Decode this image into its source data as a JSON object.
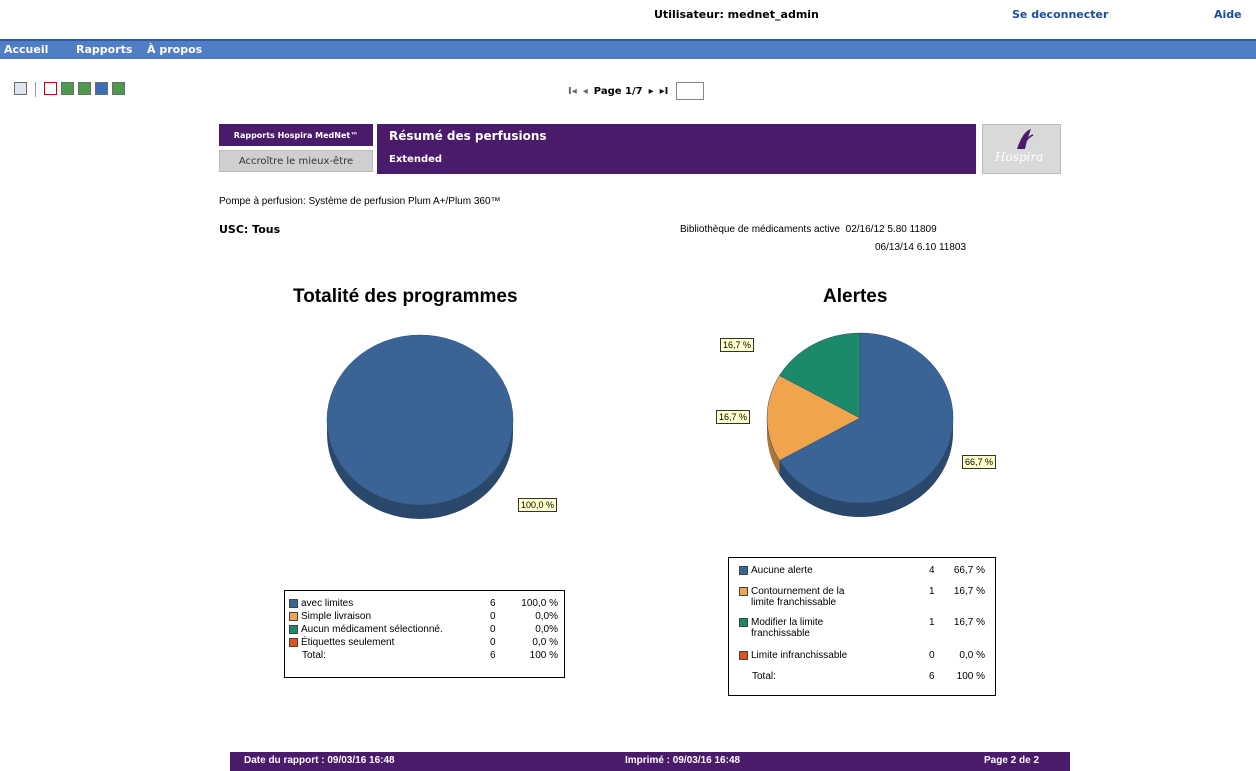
{
  "header": {
    "user_label": "Utilisateur: mednet_admin",
    "logout_label": "Se deconnecter",
    "help_label": "Aide"
  },
  "nav": {
    "items": [
      "Accueil",
      "Rapports",
      "À propos"
    ]
  },
  "toolbar": {
    "icons": [
      "export-icon",
      "pdf-icon",
      "excel-icon",
      "excel-data-icon",
      "word-icon",
      "powerpoint-icon"
    ]
  },
  "pager": {
    "first_glyph": "I◂",
    "prev_glyph": "◂",
    "page_text": "Page 1/7",
    "next_glyph": "▸",
    "last_glyph": "▸I",
    "page_input_value": ""
  },
  "report_header": {
    "brand_label": "Rapports Hospira MedNet™",
    "tagline": "Accroître le mieux-être",
    "title": "Résumé des perfusions",
    "subtitle": "Extended",
    "logo_text": "Hospira"
  },
  "info": {
    "pump_line": "Pompe à perfusion: Système de perfusion Plum A+/Plum 360™",
    "usc_line": "USC: Tous",
    "library_label": "Bibliothèque de médicaments active",
    "library_line1": "02/16/12 5.80 11809",
    "library_line2": "06/13/14 6.10 11803"
  },
  "chart_data": [
    {
      "type": "pie",
      "title": "Totalité des programmes",
      "series": [
        {
          "name": "avec limites",
          "value": 6,
          "percent": "100,0 %",
          "color": "#3a6496"
        },
        {
          "name": "Simple livraison",
          "value": 0,
          "percent": "0,0%",
          "color": "#f0a44c"
        },
        {
          "name": "Aucun médicament sélectionné.",
          "value": 0,
          "percent": "0,0%",
          "color": "#1a8a6a"
        },
        {
          "name": "Étiquettes seulement",
          "value": 0,
          "percent": "0,0 %",
          "color": "#e0541c"
        }
      ],
      "total_label": "Total:",
      "total_count": 6,
      "total_percent": "100 %",
      "callouts": [
        "100,0 %"
      ]
    },
    {
      "type": "pie",
      "title": "Alertes",
      "series": [
        {
          "name": "Aucune alerte",
          "value": 4,
          "percent": "66,7 %",
          "color": "#3a6496"
        },
        {
          "name": "Contournement de la limite franchissable",
          "value": 1,
          "percent": "16,7 %",
          "color": "#f0a44c"
        },
        {
          "name": "Modifier la limite franchissable",
          "value": 1,
          "percent": "16,7 %",
          "color": "#1a8a6a"
        },
        {
          "name": "Limite infranchissable",
          "value": 0,
          "percent": "0,0 %",
          "color": "#e0541c"
        }
      ],
      "total_label": "Total:",
      "total_count": 6,
      "total_percent": "100 %",
      "callouts": [
        "66,7 %",
        "16,7 %",
        "16,7 %"
      ]
    }
  ],
  "legend1": {
    "rows": [
      {
        "label": "avec limites",
        "count": "6",
        "pct": "100,0 %"
      },
      {
        "label": "Simple livraison",
        "count": "0",
        "pct": "0,0%"
      },
      {
        "label": "Aucun médicament sélectionné.",
        "count": "0",
        "pct": "0,0%"
      },
      {
        "label": "Étiquettes seulement",
        "count": "0",
        "pct": "0,0 %"
      }
    ],
    "total_label": "Total:",
    "total_count": "6",
    "total_pct": "100 %"
  },
  "legend2": {
    "rows": [
      {
        "label1": "Aucune alerte",
        "label2": "",
        "count": "4",
        "pct": "66,7 %"
      },
      {
        "label1": "Contournement de la",
        "label2": "limite franchissable",
        "count": "1",
        "pct": "16,7 %"
      },
      {
        "label1": "Modifier la limite",
        "label2": "franchissable",
        "count": "1",
        "pct": "16,7 %"
      },
      {
        "label1": "Limite infranchissable",
        "label2": "",
        "count": "0",
        "pct": "0,0 %"
      }
    ],
    "total_label": "Total:",
    "total_count": "6",
    "total_pct": "100 %"
  },
  "footer": {
    "report_date": "Date du rapport : 09/03/16 16:48",
    "printed": "Imprimé : 09/03/16 16:48",
    "page": "Page 2 de 2"
  }
}
